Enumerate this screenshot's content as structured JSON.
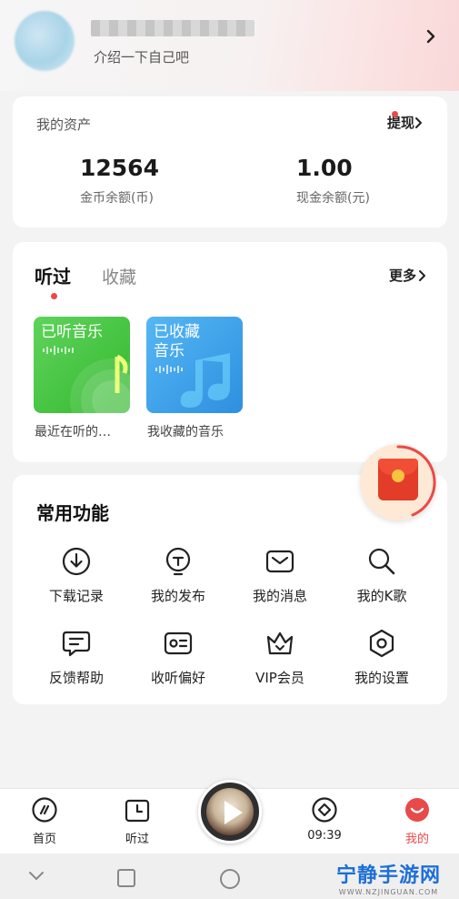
{
  "profile": {
    "intro": "介绍一下自己吧"
  },
  "assets": {
    "title": "我的资产",
    "withdraw_label": "提现",
    "coins": {
      "value": "12564",
      "label": "金币余额(币)"
    },
    "cash": {
      "value": "1.00",
      "label": "现金余额(元)"
    }
  },
  "history": {
    "tabs": [
      "听过",
      "收藏"
    ],
    "more_label": "更多",
    "tiles": [
      {
        "title": "已听音乐",
        "caption": "最近在听的…"
      },
      {
        "title_line1": "已收藏",
        "title_line2": "音乐",
        "caption": "我收藏的音乐"
      }
    ]
  },
  "functions": {
    "heading": "常用功能",
    "items": [
      {
        "label": "下载记录",
        "icon": "download-icon"
      },
      {
        "label": "我的发布",
        "icon": "publish-icon"
      },
      {
        "label": "我的消息",
        "icon": "message-icon"
      },
      {
        "label": "我的K歌",
        "icon": "search-icon"
      },
      {
        "label": "反馈帮助",
        "icon": "feedback-icon"
      },
      {
        "label": "收听偏好",
        "icon": "preference-icon"
      },
      {
        "label": "VIP会员",
        "icon": "crown-icon"
      },
      {
        "label": "我的设置",
        "icon": "settings-icon"
      }
    ]
  },
  "bottom_nav": {
    "items": [
      {
        "label": "首页",
        "icon": "home-icon"
      },
      {
        "label": "听过",
        "icon": "history-icon"
      },
      {
        "label": "09:39",
        "icon": "diamond-icon"
      },
      {
        "label": "我的",
        "icon": "profile-icon"
      }
    ],
    "active_color": "#e84a4a"
  },
  "watermark": {
    "title": "宁静手游网",
    "url": "WWW.NZJINGUAN.COM"
  }
}
